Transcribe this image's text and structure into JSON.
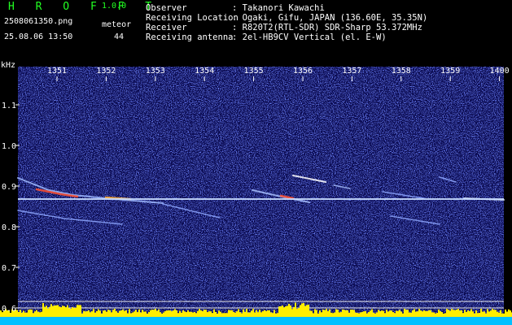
{
  "header": {
    "app_name": "H R O F F T",
    "version": "1.0.0",
    "filename": "2508061350.png",
    "datetime": "25.08.06 13:50",
    "meteor_label": "meteor",
    "meteor_count": "44",
    "observer_label": "Observer",
    "observer_value": ": Takanori Kawachi",
    "location_label": "Receiving Location",
    "location_value": ": Ogaki, Gifu, JAPAN (136.60E, 35.35N)",
    "receiver_label": "Receiver",
    "receiver_value": ": R820T2(RTL-SDR) SDR-Sharp 53.372MHz",
    "antenna_label": "Receiving antenna",
    "antenna_value": ": 2el-HB9CV Vertical (el. E-W)"
  },
  "spectrogram": {
    "y_unit": "kHz",
    "y_ticks": [
      "1.1",
      "1.0",
      "0.9",
      "0.8",
      "0.7",
      "0.6"
    ],
    "x_ticks": [
      "1351",
      "1352",
      "1353",
      "1354",
      "1355",
      "1356",
      "1357",
      "1358",
      "1359",
      "1400"
    ],
    "colors": {
      "background": "#0a0a50",
      "noise_a": "#1f2fb0",
      "noise_b": "#3a4ae0",
      "carrier": "#c8dcff",
      "hot": "#ff5030",
      "meter": "#ffee00",
      "meter_base": "#00c0ff"
    }
  }
}
